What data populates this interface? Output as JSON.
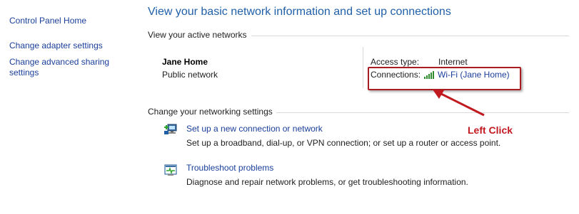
{
  "sidebar": {
    "items": [
      {
        "label": "Control Panel Home"
      },
      {
        "label": "Change adapter settings"
      },
      {
        "label": "Change advanced sharing settings"
      }
    ]
  },
  "main": {
    "title": "View your basic network information and set up connections",
    "active_networks": {
      "header": "View your active networks",
      "network_name": "Jane Home",
      "network_category": "Public network",
      "access_type_label": "Access type:",
      "access_type_value": "Internet",
      "connections_label": "Connections:",
      "connections_value": "Wi-Fi (Jane Home)"
    },
    "networking_settings": {
      "header": "Change your networking settings",
      "tasks": [
        {
          "label": "Set up a new connection or network",
          "description": "Set up a broadband, dial-up, or VPN connection; or set up a router or access point.",
          "icon": "new-connection-icon"
        },
        {
          "label": "Troubleshoot problems",
          "description": "Diagnose and repair network problems, or get troubleshooting information.",
          "icon": "troubleshoot-icon"
        }
      ]
    }
  },
  "annotation": {
    "text": "Left Click",
    "color": "#c0191f"
  },
  "colors": {
    "link": "#1a3e9a",
    "title": "#1f5fa8",
    "highlight": "#a91d22"
  }
}
